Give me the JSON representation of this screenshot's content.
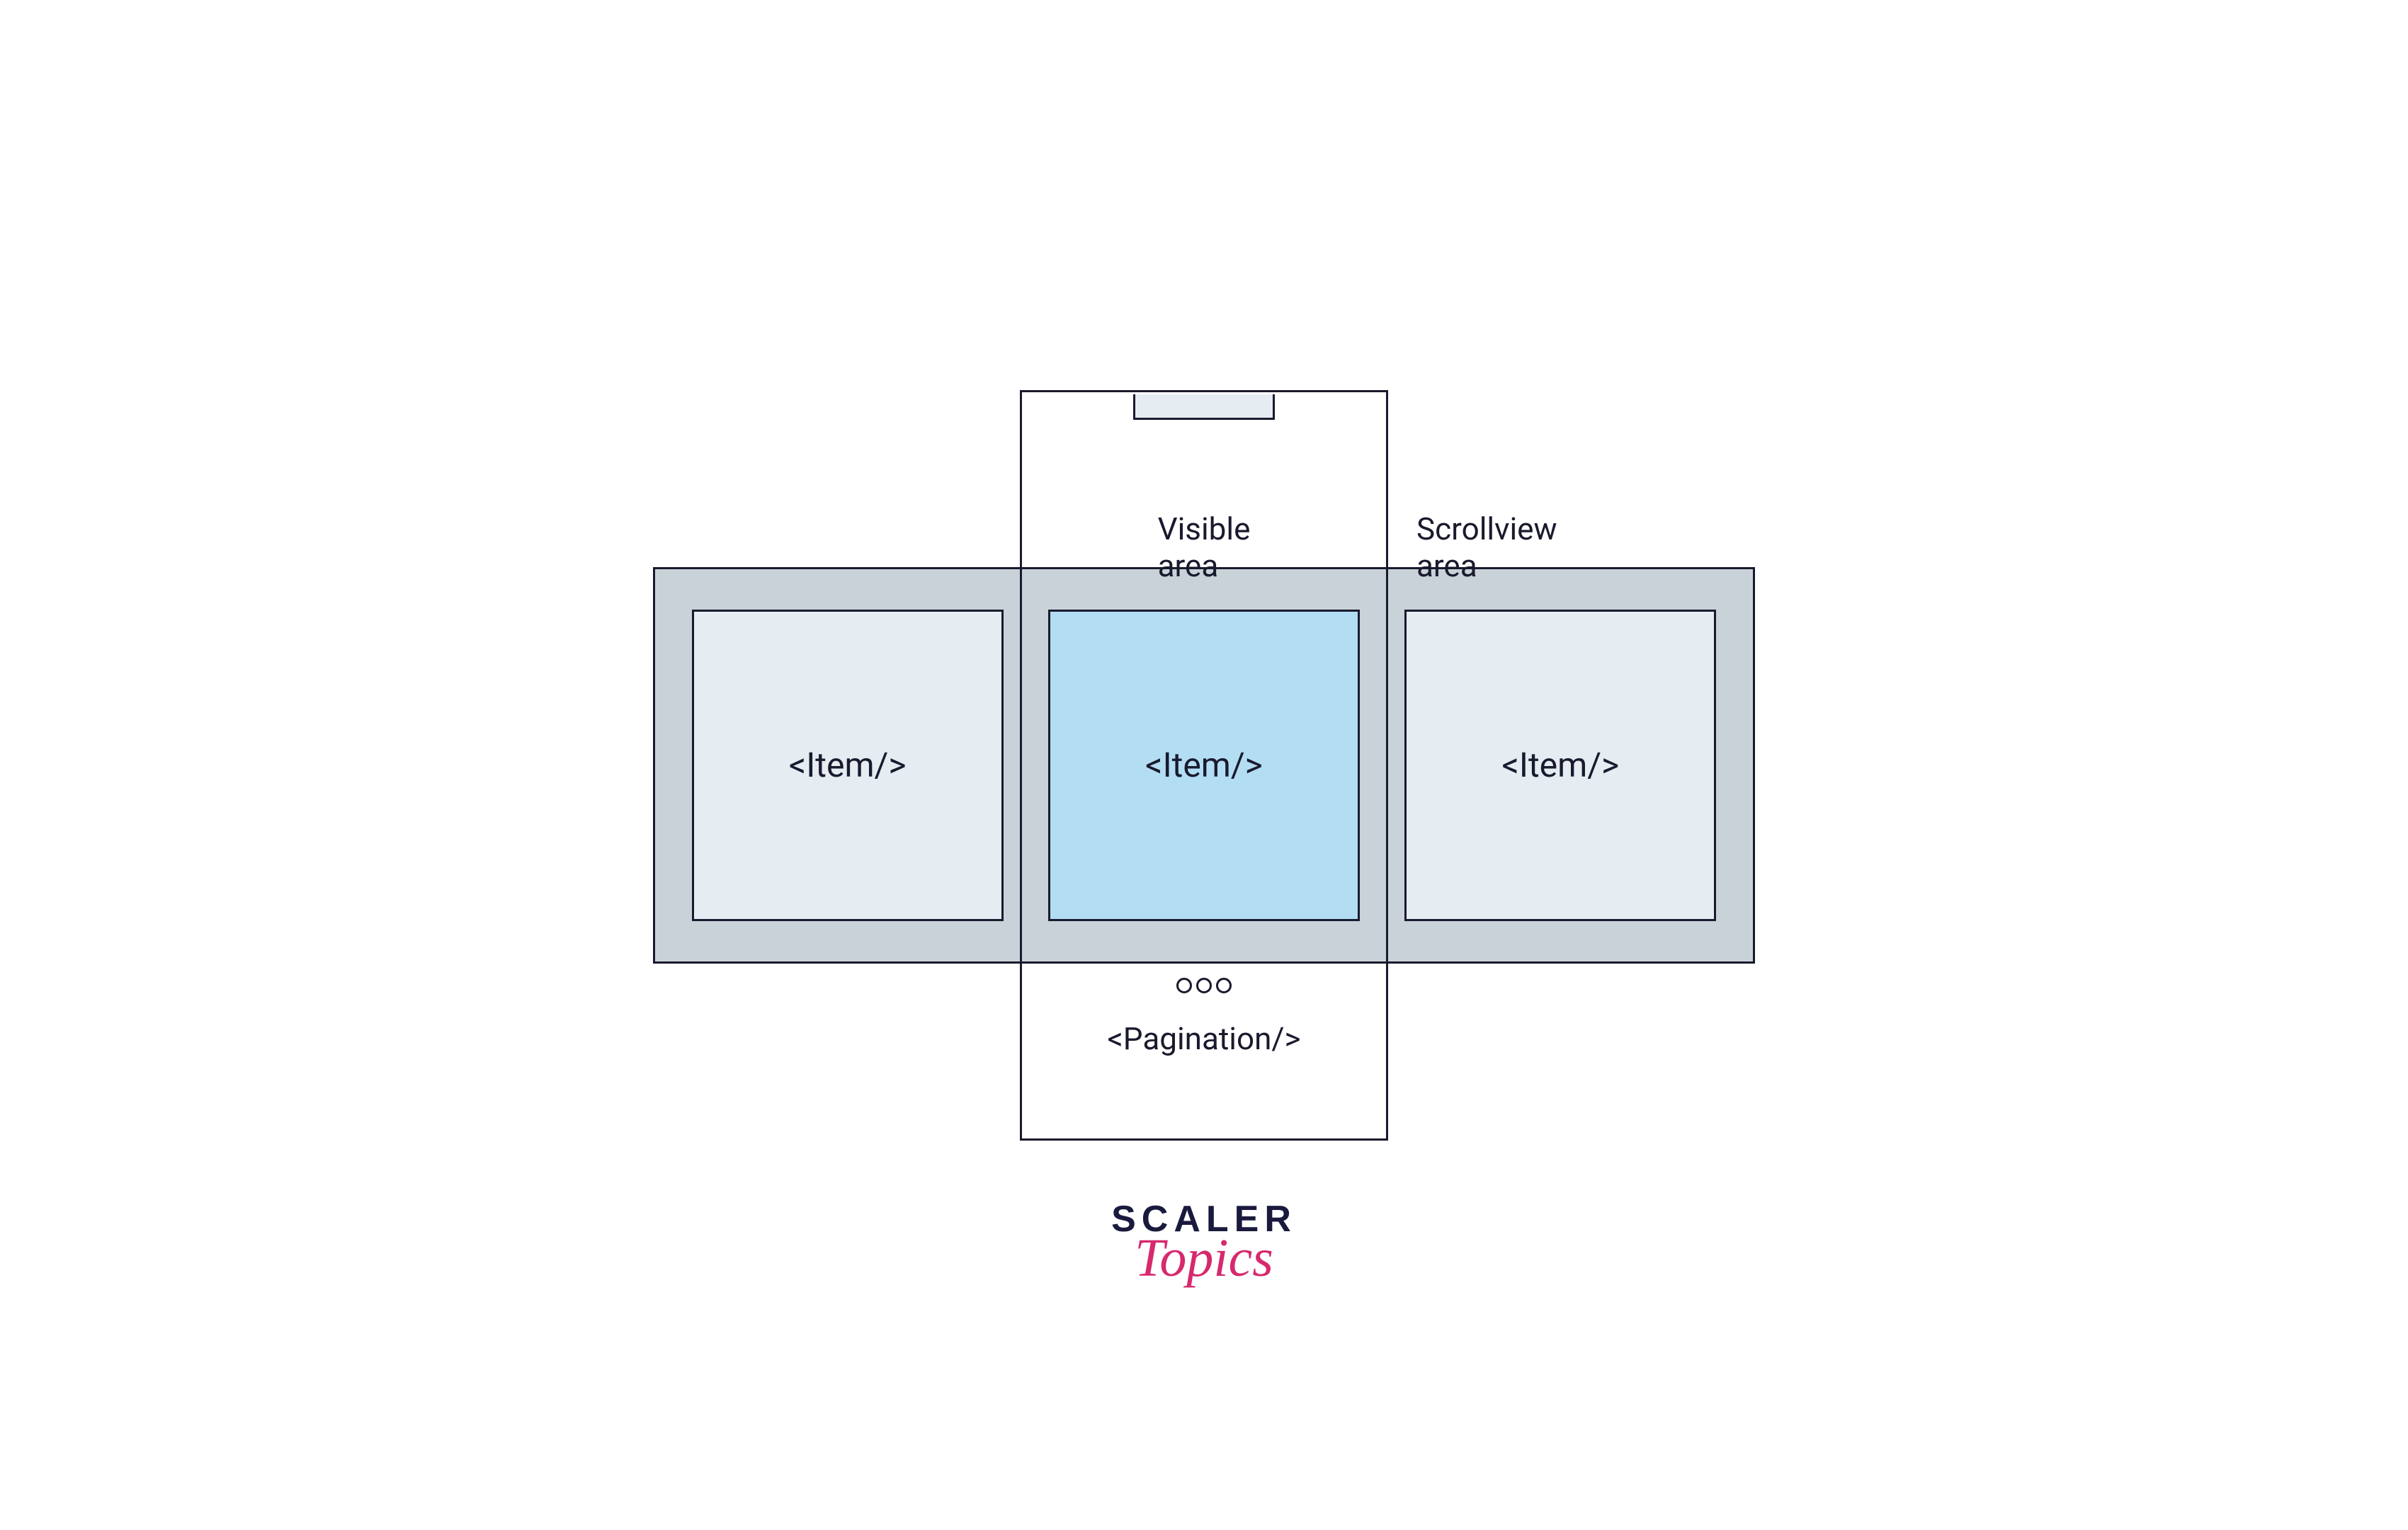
{
  "labels": {
    "visible_area": "Visible area",
    "scrollview_area": "Scrollview area",
    "pagination": "<Pagination/>"
  },
  "items": [
    {
      "label": "<Item/>",
      "active": false
    },
    {
      "label": "<Item/>",
      "active": true
    },
    {
      "label": "<Item/>",
      "active": false
    }
  ],
  "pagination_dots": 3,
  "brand": {
    "line1": "SCALER",
    "line2": "Topics"
  },
  "colors": {
    "stroke": "#1a1a2e",
    "strip_bg": "#c9d2d8",
    "item_inactive": "#e5ecf2",
    "item_active": "#b3ddf3",
    "brand_accent": "#d6296e"
  }
}
